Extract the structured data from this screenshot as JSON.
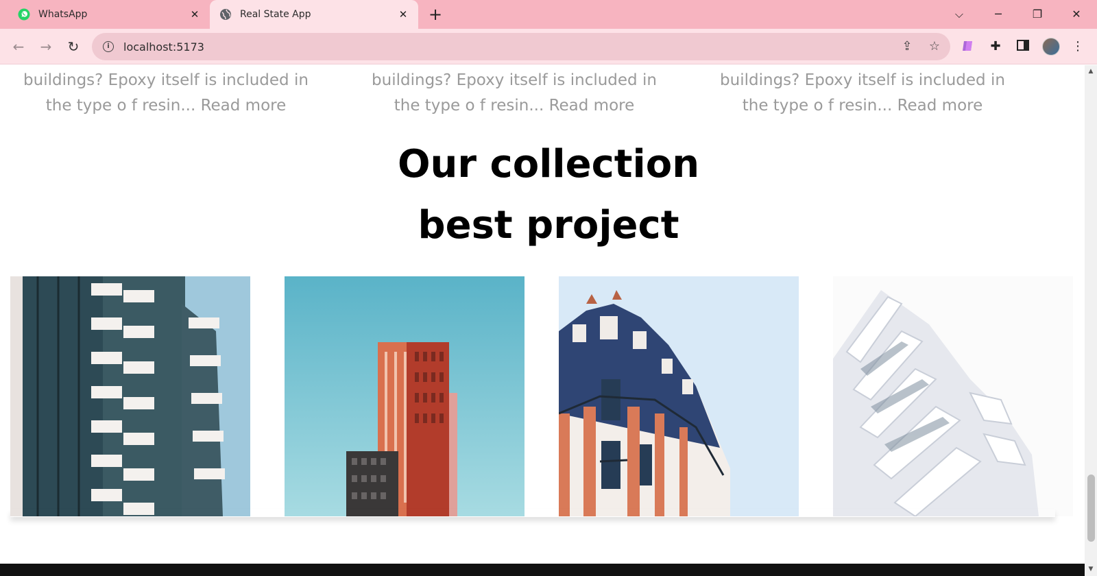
{
  "browser": {
    "tabs": [
      {
        "title": "WhatsApp",
        "icon": "whatsapp-icon"
      },
      {
        "title": "Real State App",
        "icon": "globe-icon",
        "active": true
      }
    ],
    "new_tab_symbol": "+",
    "address": "localhost:5173"
  },
  "page": {
    "blurbs": [
      {
        "line1": "buildings? Epoxy itself is included in",
        "line2": "the type o f resin... Read more"
      },
      {
        "line1": "buildings? Epoxy itself is included in",
        "line2": "the type o f resin... Read more"
      },
      {
        "line1": "buildings? Epoxy itself is included in",
        "line2": "the type o f resin... Read more"
      }
    ],
    "heading_line1": "Our collection",
    "heading_line2": "best project",
    "projects": [
      {
        "name": "balcony-tower",
        "sky_color": "#9fc8dc"
      },
      {
        "name": "red-tower",
        "sky_color": "#5fb5c9"
      },
      {
        "name": "parisian-building",
        "sky_color": "#d5e7f5"
      },
      {
        "name": "white-modern-building",
        "sky_color": "#fbfbfb"
      }
    ]
  },
  "colors": {
    "tabstrip": "#f7b4c0",
    "toolbar": "#fde2e7",
    "omnibox": "#f0c9d1",
    "blurb_text": "#9a9a9a",
    "heading": "#000000"
  }
}
